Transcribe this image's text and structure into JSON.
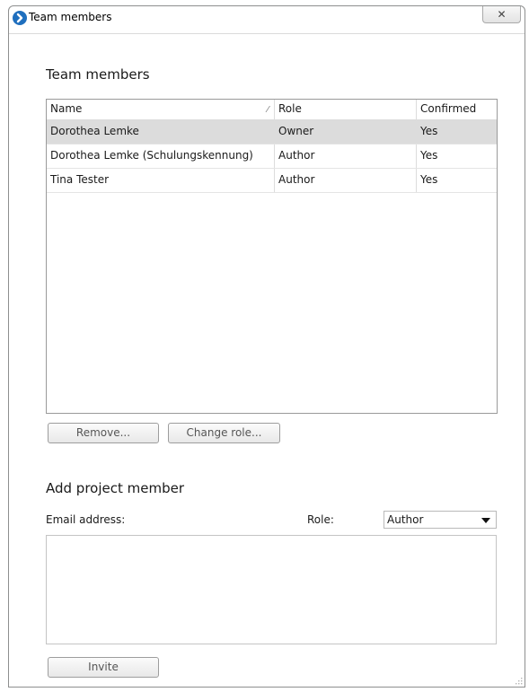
{
  "window": {
    "title": "Team members",
    "close_glyph": "✕"
  },
  "team_section": {
    "heading": "Team members",
    "columns": [
      "Name",
      "Role",
      "Confirmed"
    ],
    "sort_glyph": "⁄",
    "rows": [
      {
        "name": "Dorothea Lemke",
        "role": "Owner",
        "confirmed": "Yes",
        "selected": true
      },
      {
        "name": "Dorothea Lemke (Schulungskennung)",
        "role": "Author",
        "confirmed": "Yes",
        "selected": false
      },
      {
        "name": "Tina Tester",
        "role": "Author",
        "confirmed": "Yes",
        "selected": false
      }
    ],
    "remove_label": "Remove...",
    "change_role_label": "Change role..."
  },
  "add_section": {
    "heading": "Add project member",
    "email_label": "Email address:",
    "role_label": "Role:",
    "role_value": "Author",
    "email_value": "",
    "invite_label": "Invite"
  },
  "icons": [
    "app-icon",
    "close-icon",
    "sort-indicator-icon",
    "dropdown-caret-icon",
    "resize-grip-icon"
  ],
  "colors": {
    "selected_row": "#dcdcdc",
    "app_icon": "#1f6fbe"
  }
}
